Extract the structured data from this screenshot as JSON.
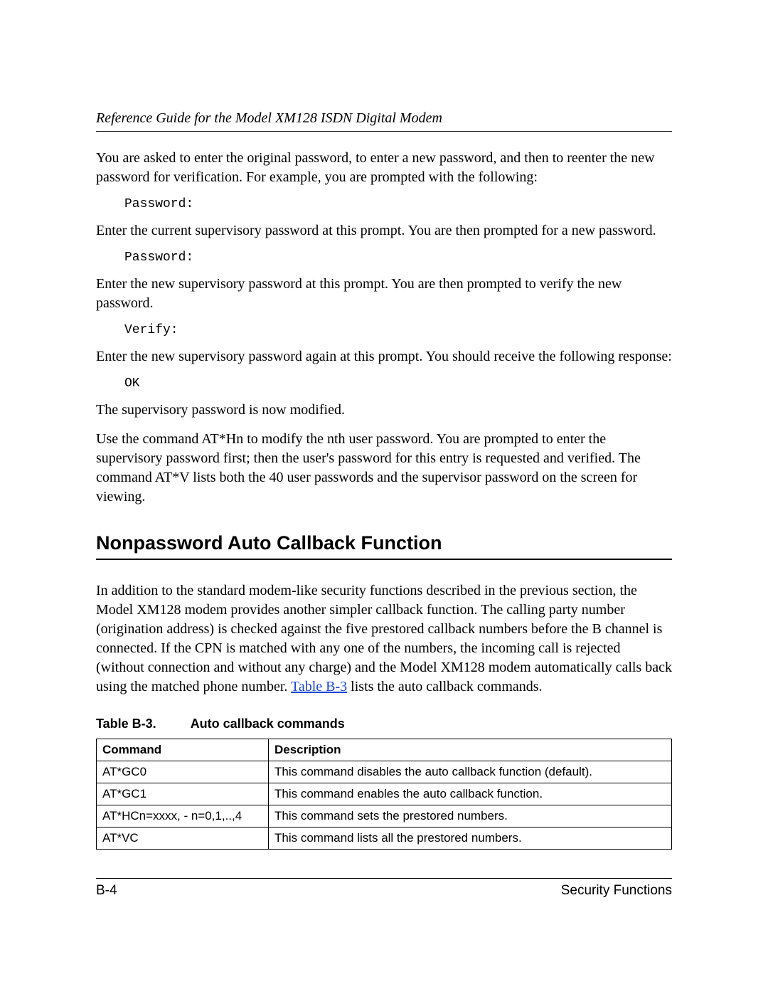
{
  "header": {
    "running_title": "Reference Guide for the Model XM128 ISDN Digital Modem"
  },
  "body": {
    "p1": "You are asked to enter the original password, to enter a new password, and then to reenter the new password for verification. For example, you are prompted with the following:",
    "code1": "Password:",
    "p2": "Enter the current supervisory password at this prompt. You are then prompted for a new password.",
    "code2": "Password:",
    "p3": "Enter the new supervisory password at this prompt. You are then prompted to verify the new password.",
    "code3": "Verify:",
    "p4": "Enter the new supervisory password again at this prompt. You should receive the following response:",
    "code4": "OK",
    "p5": "The supervisory password is now modified.",
    "p6": "Use the command AT*Hn to modify the nth user password. You are prompted to enter the supervisory password first; then the user's password for this entry is requested and verified. The command AT*V lists both the 40 user passwords and the supervisor password on the screen for viewing."
  },
  "section": {
    "title": "Nonpassword Auto Callback Function",
    "intro_a": "In addition to the standard modem-like security functions described in the previous section, the Model XM128 modem provides another simpler callback function. The calling party number (origination address) is checked against the five prestored callback numbers before the B channel is connected. If the CPN is matched with any one of the numbers, the incoming call is rejected (without connection and without any charge) and the Model XM128 modem automatically calls back using the matched phone number. ",
    "intro_link": "Table B-3",
    "intro_b": " lists the auto callback commands."
  },
  "table": {
    "caption_label": "Table B-3.",
    "caption_title": "Auto callback commands",
    "headers": {
      "col1": "Command",
      "col2": "Description"
    },
    "rows": [
      {
        "cmd": "AT*GC0",
        "desc": "This command disables the auto callback function (default)."
      },
      {
        "cmd": "AT*GC1",
        "desc": "This command enables the auto callback function."
      },
      {
        "cmd": "AT*HCn=xxxx, - n=0,1,..,4",
        "desc": "This command sets the prestored numbers."
      },
      {
        "cmd": "AT*VC",
        "desc": "This command lists all the prestored numbers."
      }
    ]
  },
  "footer": {
    "page_number": "B-4",
    "section_name": "Security Functions"
  }
}
